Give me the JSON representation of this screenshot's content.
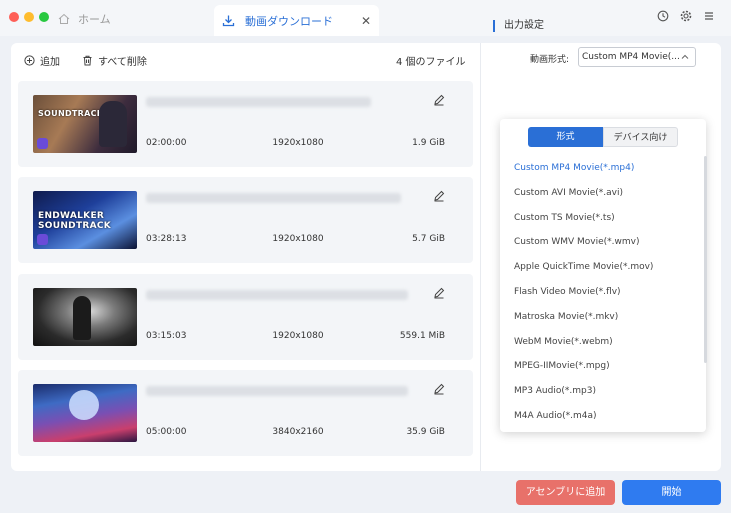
{
  "titlebar": {
    "traffic_lights": [
      "#fe5f57",
      "#febc2e",
      "#28c840"
    ],
    "home_tab": "ホーム",
    "active_tab": "動画ダウンロード",
    "close": "✕"
  },
  "toolbar": {
    "add_label": "追加",
    "delete_all_label": "すべて削除",
    "file_count": "4 個のファイル"
  },
  "items": [
    {
      "thumb_text": "SOUNDTRACK",
      "duration": "02:00:00",
      "resolution": "1920x1080",
      "size": "1.9 GiB"
    },
    {
      "thumb_text": "ENDWALKER SOUNDTRACK",
      "duration": "03:28:13",
      "resolution": "1920x1080",
      "size": "5.7 GiB"
    },
    {
      "thumb_text": "",
      "duration": "03:15:03",
      "resolution": "1920x1080",
      "size": "559.1 MiB"
    },
    {
      "thumb_text": "",
      "duration": "05:00:00",
      "resolution": "3840x2160",
      "size": "35.9 GiB"
    }
  ],
  "settings": {
    "title": "出力設定",
    "format_label": "動画形式:",
    "format_value": "Custom MP4 Movie(...",
    "tabs": [
      "形式",
      "デバイス向け"
    ],
    "options": [
      "Custom MP4 Movie(*.mp4)",
      "Custom AVI Movie(*.avi)",
      "Custom TS Movie(*.ts)",
      "Custom WMV Movie(*.wmv)",
      "Apple QuickTime Movie(*.mov)",
      "Flash Video Movie(*.flv)",
      "Matroska Movie(*.mkv)",
      "WebM Movie(*.webm)",
      "MPEG-IIMovie(*.mpg)",
      "MP3 Audio(*.mp3)",
      "M4A Audio(*.m4a)"
    ],
    "selected_index": 0
  },
  "buttons": {
    "assembly": "アセンブリに追加",
    "start": "開始"
  },
  "colors": {
    "accent": "#2a6fd6",
    "danger": "#e8716a",
    "primary": "#2f7bf0"
  }
}
